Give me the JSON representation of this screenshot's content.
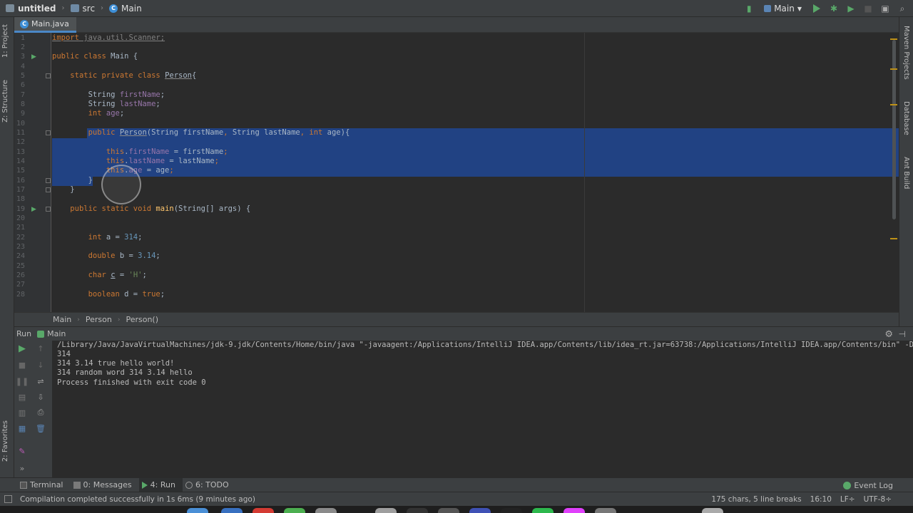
{
  "navbar": {
    "project": "untitled",
    "folder": "src",
    "class": "Main"
  },
  "toolbar": {
    "run_config": "Main"
  },
  "left_strip": {
    "project_tab": "1: Project",
    "structure_tab": "Z: Structure",
    "favorites_tab": "2: Favorites"
  },
  "right_strip": {
    "maven_tab": "Maven Projects",
    "database_tab": "Database",
    "ant_tab": "Ant Build"
  },
  "editor_tab": {
    "label": "Main.java"
  },
  "editor": {
    "line_numbers": [
      "1",
      "2",
      "3",
      "4",
      "5",
      "6",
      "7",
      "8",
      "9",
      "10",
      "11",
      "12",
      "13",
      "14",
      "15",
      "16",
      "17",
      "18",
      "19",
      "20",
      "21",
      "22",
      "23",
      "24",
      "25",
      "26",
      "27",
      "28"
    ]
  },
  "breadcrumb": {
    "items": [
      "Main",
      "Person",
      "Person()"
    ]
  },
  "run_panel": {
    "title": "Run",
    "tab": "Main",
    "output": [
      "/Library/Java/JavaVirtualMachines/jdk-9.jdk/Contents/Home/bin/java \"-javaagent:/Applications/IntelliJ IDEA.app/Contents/lib/idea_rt.jar=63738:/Applications/IntelliJ IDEA.app/Contents/bin\" -D",
      "314",
      "314 3.14 true hello world!",
      "314 random word 314 3.14 hello",
      "Process finished with exit code 0"
    ]
  },
  "tool_windows": {
    "terminal": "Terminal",
    "messages": "0: Messages",
    "run": "4: Run",
    "todo": "6: TODO",
    "event_log": "Event Log"
  },
  "status": {
    "message": "Compilation completed successfully in 1s 6ms (9 minutes ago)",
    "chars": "175 chars, 5 line breaks",
    "position": "16:10",
    "line_sep": "LF÷",
    "encoding": "UTF-8÷"
  },
  "colors": {
    "selection": "#214283",
    "keyword": "#cc7832",
    "field": "#9876aa",
    "number": "#6897bb",
    "string": "#6a8759",
    "method": "#ffc66d",
    "run_green": "#59a869"
  }
}
